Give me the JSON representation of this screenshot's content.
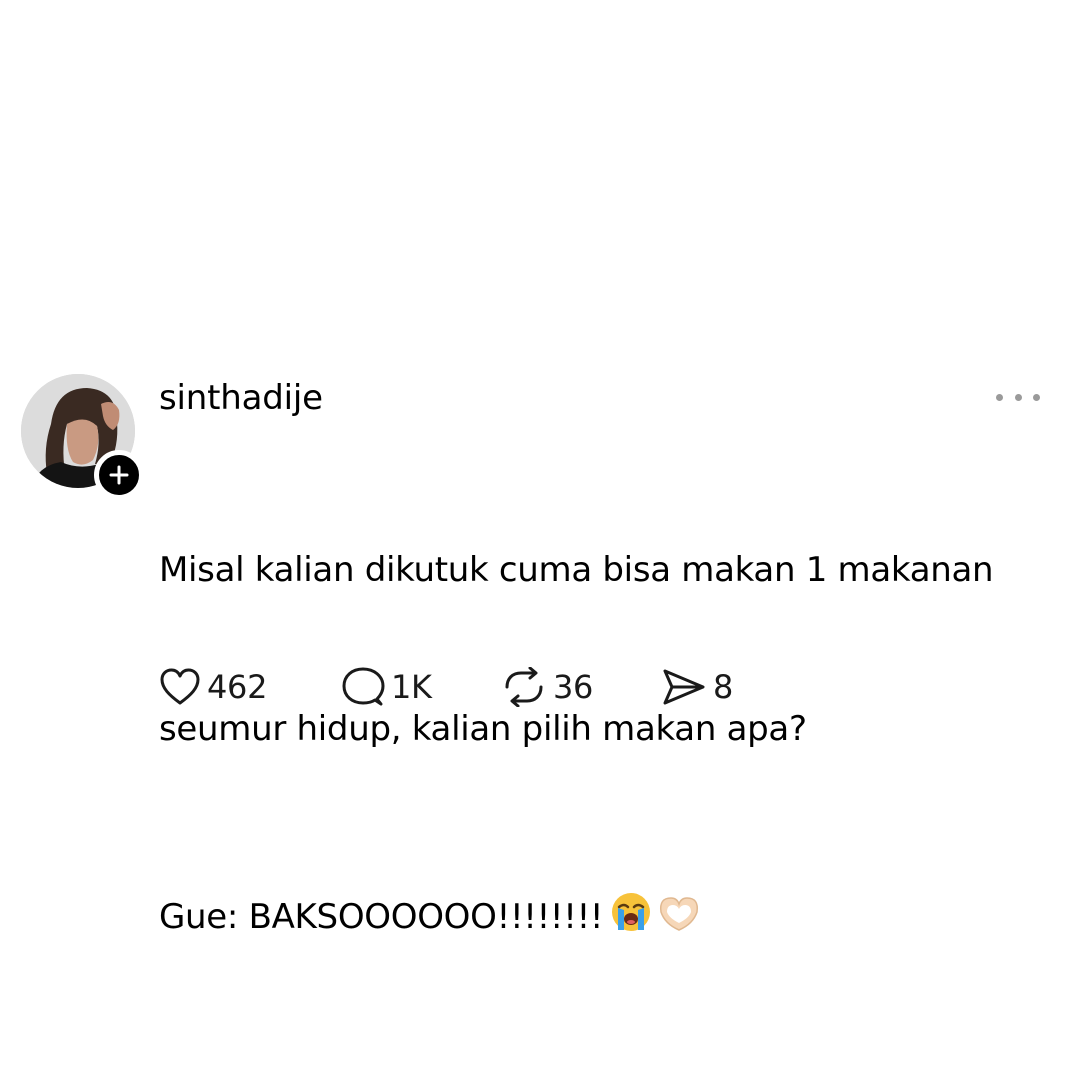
{
  "post": {
    "username": "sinthadije",
    "lines": [
      "Misal kalian dikutuk cuma bisa makan 1 makanan",
      "seumur hidup, kalian pilih makan apa?"
    ],
    "reply_line": "Gue: BAKSOOOOOO!!!!!!!!",
    "emojis": [
      "loudly-crying-face-icon",
      "heart-hands-icon"
    ]
  },
  "actions": {
    "likes": "462",
    "replies": "1K",
    "reposts": "36",
    "shares": "8"
  },
  "colors": {
    "text": "#000000",
    "muted": "#9a9a9a",
    "badge": "#000000"
  }
}
